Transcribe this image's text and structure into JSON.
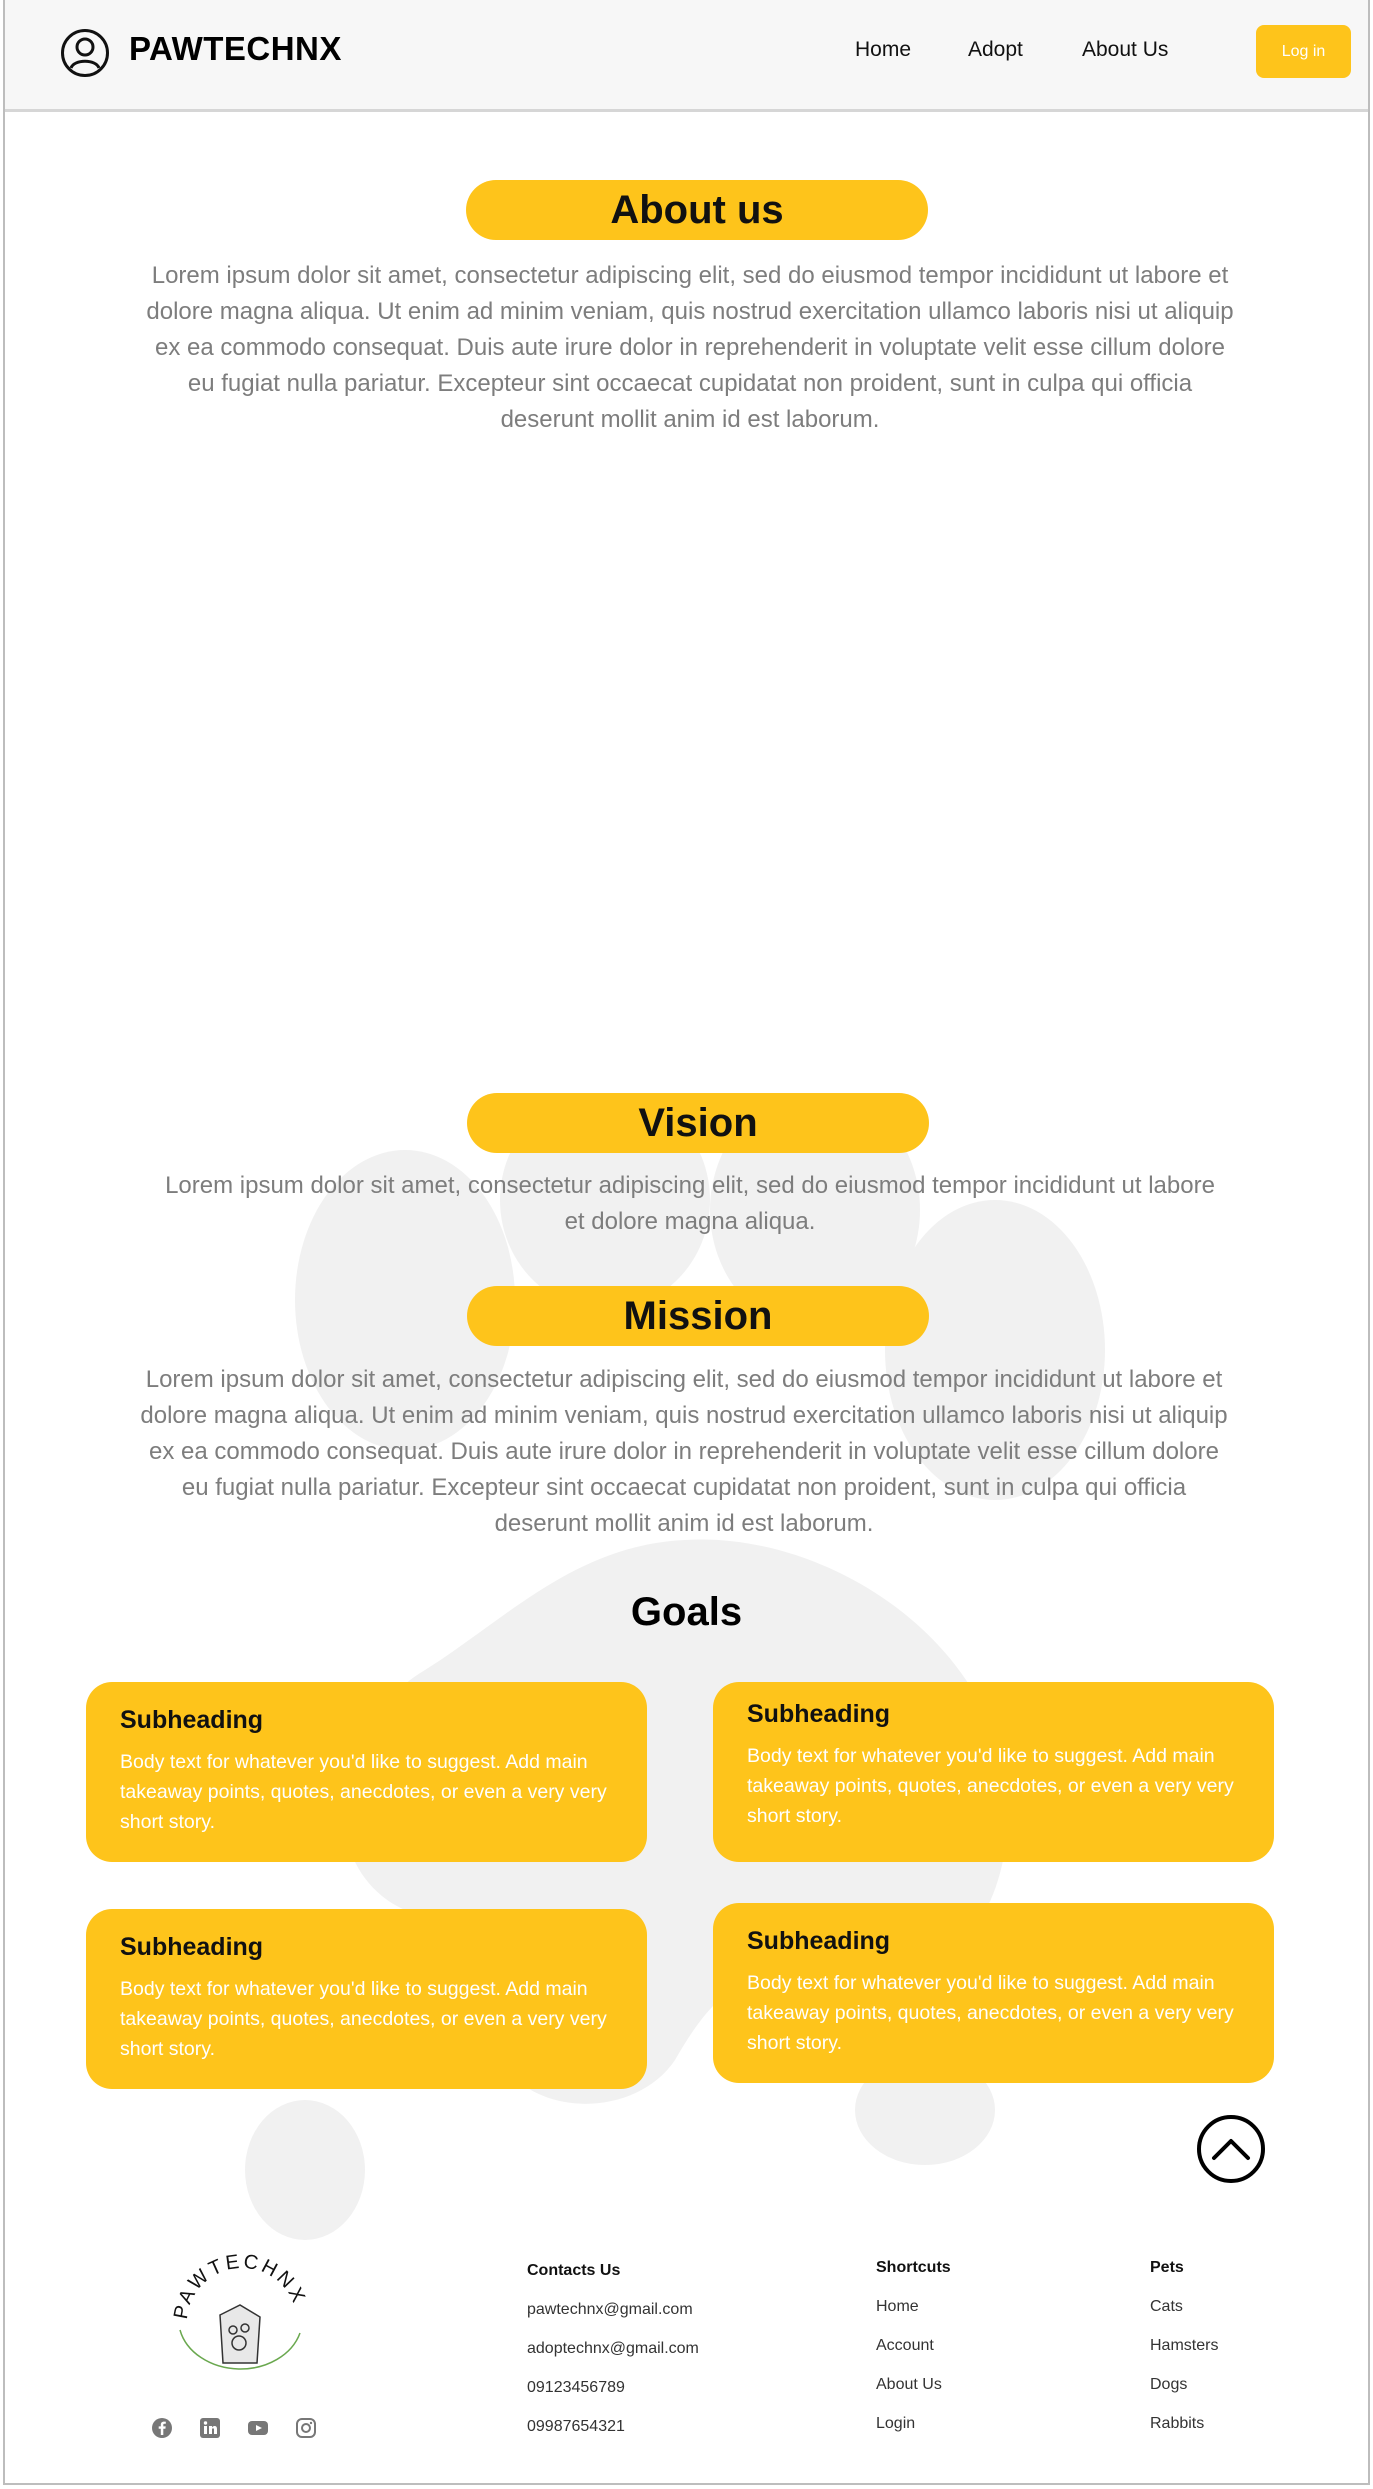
{
  "header": {
    "brand": "PAWTECHNX",
    "nav": [
      "Home",
      "Adopt",
      "About Us"
    ],
    "login_label": "Log in"
  },
  "about": {
    "title": "About us",
    "text": "Lorem ipsum dolor sit amet, consectetur adipiscing elit, sed do eiusmod tempor incididunt ut labore et dolore magna aliqua. Ut enim ad minim veniam, quis nostrud exercitation ullamco laboris nisi ut aliquip ex ea commodo consequat. Duis aute irure dolor in reprehenderit in voluptate velit esse cillum dolore eu fugiat nulla pariatur. Excepteur sint occaecat cupidatat non proident, sunt in culpa qui officia deserunt mollit anim id est laborum."
  },
  "vision": {
    "title": "Vision",
    "text": "Lorem ipsum dolor sit amet, consectetur adipiscing elit, sed do eiusmod tempor incididunt ut labore et dolore magna aliqua."
  },
  "mission": {
    "title": "Mission",
    "text": "Lorem ipsum dolor sit amet, consectetur adipiscing elit, sed do eiusmod tempor incididunt ut labore et dolore magna aliqua. Ut enim ad minim veniam, quis nostrud exercitation ullamco laboris nisi ut aliquip ex ea commodo consequat. Duis aute irure dolor in reprehenderit in voluptate velit esse cillum dolore eu fugiat nulla pariatur. Excepteur sint occaecat cupidatat non proident, sunt in culpa qui officia deserunt mollit anim id est laborum."
  },
  "goals": {
    "title": "Goals",
    "cards": [
      {
        "heading": "Subheading",
        "body": "Body text for whatever you'd like to suggest. Add main takeaway points, quotes, anecdotes, or even a very very short story."
      },
      {
        "heading": "Subheading",
        "body": "Body text for whatever you'd like to suggest. Add main takeaway points, quotes, anecdotes, or even a very very short story."
      },
      {
        "heading": "Subheading",
        "body": "Body text for whatever you'd like to suggest. Add main takeaway points, quotes, anecdotes, or even a very very short story."
      },
      {
        "heading": "Subheading",
        "body": "Body text for whatever you'd like to suggest. Add main takeaway points, quotes, anecdotes, or even a very very short story."
      }
    ]
  },
  "footer": {
    "logo_text": "PAWTECHNX",
    "contacts": {
      "title": "Contacts Us",
      "items": [
        "pawtechnx@gmail.com",
        "adoptechnx@gmail.com",
        "09123456789",
        "09987654321"
      ]
    },
    "shortcuts": {
      "title": "Shortcuts",
      "items": [
        "Home",
        "Account",
        "About Us",
        "Login"
      ]
    },
    "pets": {
      "title": "Pets",
      "items": [
        "Cats",
        "Hamsters",
        "Dogs",
        "Rabbits"
      ]
    },
    "social_icons": [
      "facebook-icon",
      "linkedin-icon",
      "youtube-icon",
      "instagram-icon"
    ]
  },
  "colors": {
    "accent": "#fec41b",
    "body_text": "#7d7d7d",
    "header_bg": "#f7f7f7"
  }
}
